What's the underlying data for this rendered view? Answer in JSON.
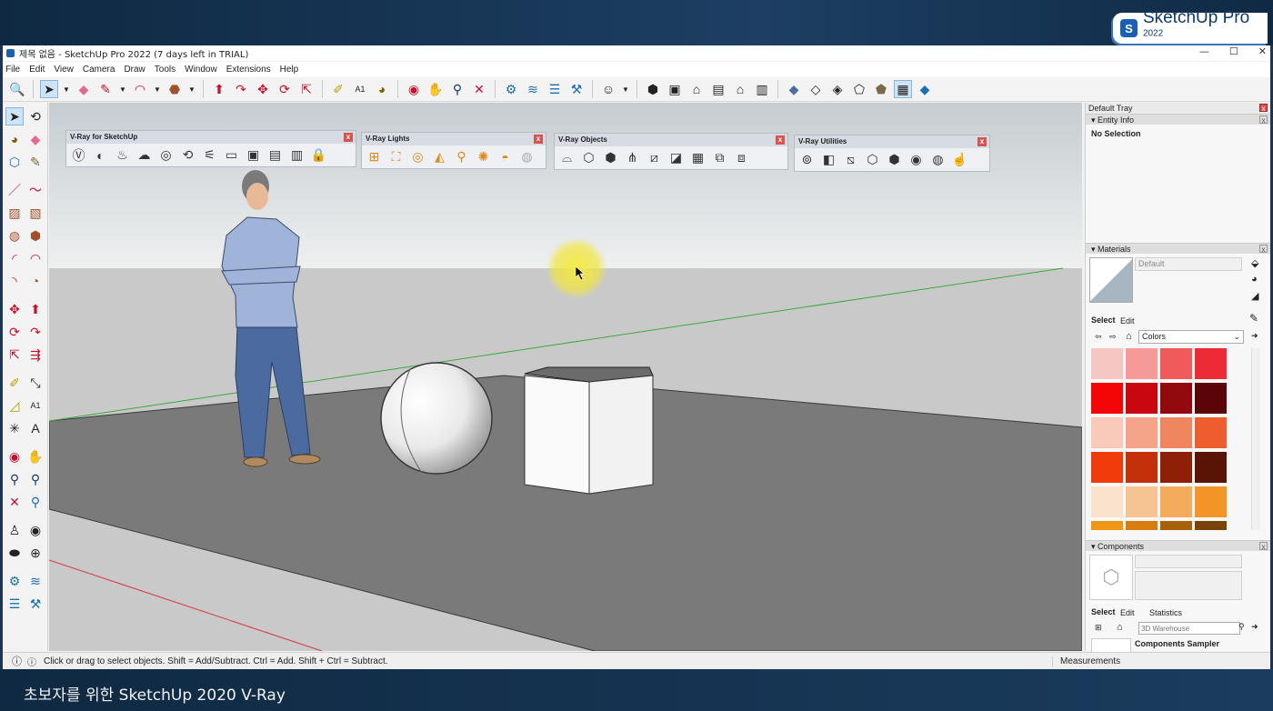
{
  "brand": {
    "name": "SketchUp Pro",
    "year": "2022"
  },
  "caption": "초보자를 위한 SketchUp 2020 V-Ray",
  "window": {
    "title": "제목 없음 - SketchUp Pro 2022 (7 days left in TRIAL)"
  },
  "menu": [
    "File",
    "Edit",
    "View",
    "Camera",
    "Draw",
    "Tools",
    "Window",
    "Extensions",
    "Help"
  ],
  "vray_toolbars": {
    "main": "V-Ray for SketchUp",
    "lights": "V-Ray Lights",
    "objects": "V-Ray Objects",
    "utilities": "V-Ray Utilities"
  },
  "tray": {
    "title": "Default Tray",
    "entity_info": {
      "header": "Entity Info",
      "value": "No Selection"
    },
    "materials": {
      "header": "Materials",
      "name_value": "Default",
      "tabs": [
        "Select",
        "Edit"
      ],
      "library": "Colors",
      "swatches": [
        "#f6c6c2",
        "#f59a98",
        "#f05a5a",
        "#ee2b35",
        "#f50606",
        "#c80710",
        "#920a0e",
        "#5c0508",
        "#f9c9b9",
        "#f5a48a",
        "#f0865e",
        "#ee5d2e",
        "#f03c0a",
        "#c3300a",
        "#8e2007",
        "#5a1405",
        "#fbe2cc",
        "#f6c493",
        "#f4ac5c",
        "#f39426",
        "#f09615",
        "#d87c0f",
        "#a8600b",
        "#7a4308"
      ]
    },
    "components": {
      "header": "Components",
      "tabs": [
        "Select",
        "Edit",
        "Statistics"
      ],
      "search_placeholder": "3D Warehouse",
      "sampler": "Components Sampler"
    }
  },
  "status": {
    "hint": "Click or drag to select objects. Shift = Add/Subtract. Ctrl = Add. Shift + Ctrl = Subtract.",
    "measurements": "Measurements"
  },
  "icons": {
    "main_toolbar": [
      "zoom-icon",
      "select-icon",
      "eraser-icon",
      "pencil-icon",
      "arc-icon",
      "paint-bucket-icon",
      "push-pull-icon",
      "follow-me-icon",
      "move-icon",
      "rotate-icon",
      "scale-icon",
      "tape-measure-icon",
      "text-icon",
      "paint-icon",
      "orbit-icon",
      "pan-icon",
      "zoom-window-icon",
      "zoom-extents-icon",
      "outliner-icon",
      "layers-icon",
      "scenes-icon",
      "styles-icon",
      "user-icon",
      "iso-view-icon",
      "top-view-icon",
      "front-view-icon",
      "right-view-icon",
      "back-view-icon",
      "left-view-icon",
      "xray-icon",
      "wireframe-icon",
      "hidden-line-icon",
      "shaded-icon",
      "textured-icon",
      "monochrome-icon",
      "solid-style-icon"
    ]
  }
}
